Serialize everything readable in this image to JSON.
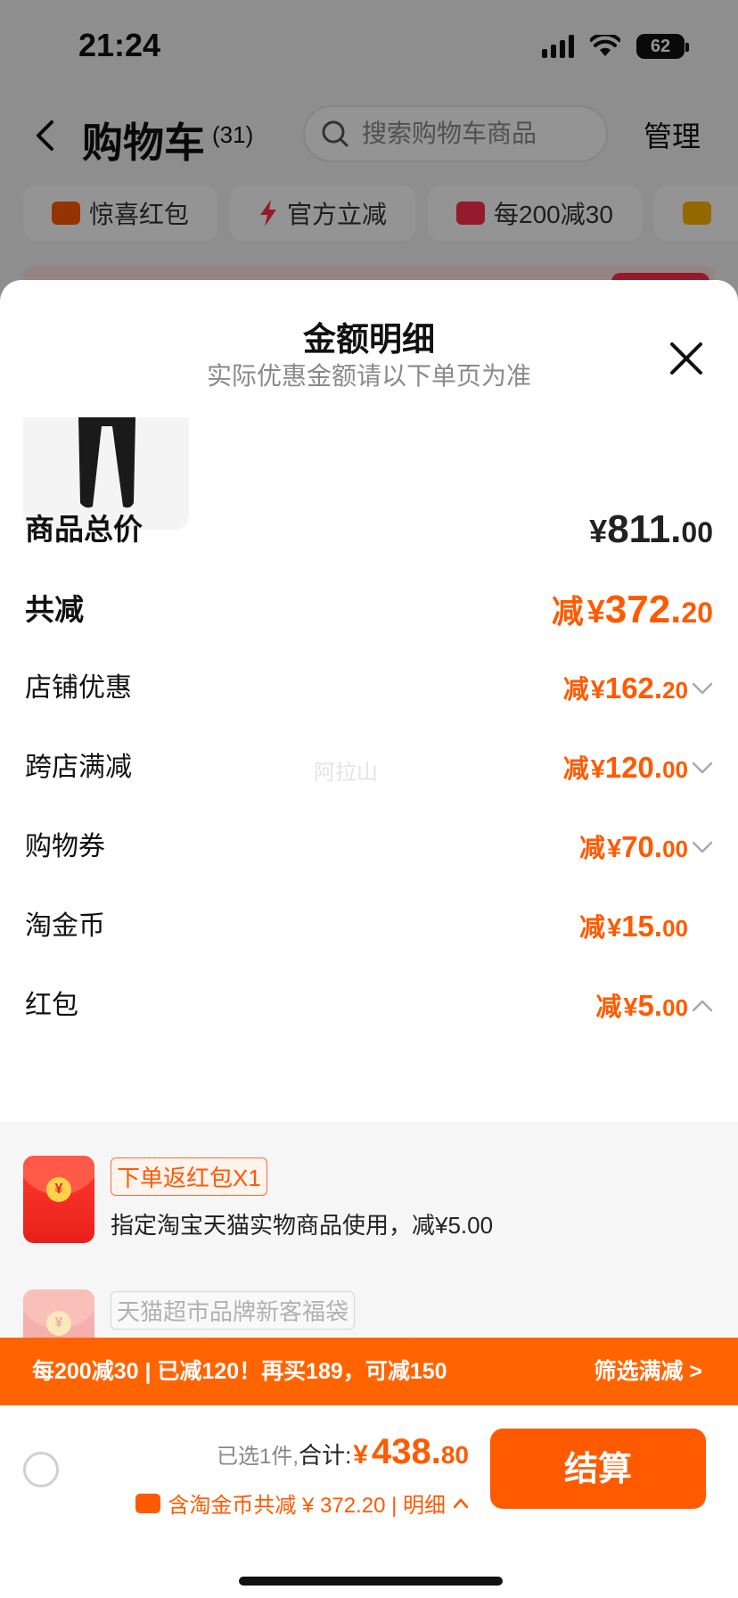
{
  "status_bar": {
    "time": "21:24",
    "battery": "62"
  },
  "cart_header": {
    "title": "购物车",
    "count": "(31)",
    "search_placeholder": "搜索购物车商品",
    "manage_label": "管理"
  },
  "promo_chips": [
    {
      "label": "惊喜红包",
      "icon": "red-envelope-icon",
      "color": "#ff5a00"
    },
    {
      "label": "官方立减",
      "icon": "lightning-icon",
      "color": "#ff2e4e"
    },
    {
      "label": "每200减30",
      "icon": "shop-icon",
      "color": "#ff2e4e"
    },
    {
      "label": "",
      "icon": "folder-icon",
      "color": "#ffb300"
    }
  ],
  "sheet": {
    "title": "金额明细",
    "subtitle": "实际优惠金额请以下单页为准",
    "watermark": "阿拉山"
  },
  "breakdown": {
    "total_price": {
      "label": "商品总价",
      "yen": "¥",
      "int": "811.",
      "dec": "00"
    },
    "total_discount": {
      "label": "共减",
      "prefix": "减",
      "yen": "¥",
      "int": "372.",
      "dec": "20"
    },
    "items": [
      {
        "label": "店铺优惠",
        "prefix": "减",
        "yen": "¥",
        "int": "162.",
        "dec": "20",
        "chevron": "chevron-down-icon"
      },
      {
        "label": "跨店满减",
        "prefix": "减",
        "yen": "¥",
        "int": "120.",
        "dec": "00",
        "chevron": "chevron-down-icon"
      },
      {
        "label": "购物券",
        "prefix": "减",
        "yen": "¥",
        "int": "70.",
        "dec": "00",
        "chevron": "chevron-down-icon"
      },
      {
        "label": "淘金币",
        "prefix": "减",
        "yen": "¥",
        "int": "15.",
        "dec": "00",
        "chevron": ""
      },
      {
        "label": "红包",
        "prefix": "减",
        "yen": "¥",
        "int": "5.",
        "dec": "00",
        "chevron": "chevron-up-icon"
      }
    ]
  },
  "red_packets": [
    {
      "tag": "下单返红包X1",
      "desc": "指定淘宝天猫实物商品使用，减¥5.00"
    },
    {
      "tag": "天猫超市品牌新客福袋",
      "desc": ""
    }
  ],
  "promo_bar": {
    "text": "每200减30 | 已减120！再买189，可减150",
    "link": "筛选满减 >"
  },
  "checkout": {
    "selected": "已选1件,",
    "total_label": "合计:",
    "yen": "¥",
    "int": "438.",
    "dec": "80",
    "discount_text": "含淘金币共减 ¥ 372.20 | 明细",
    "button": "结算"
  },
  "colors": {
    "accent": "#ff5a00",
    "promo_bar": "#ff6400",
    "red": "#ff2e4e"
  }
}
